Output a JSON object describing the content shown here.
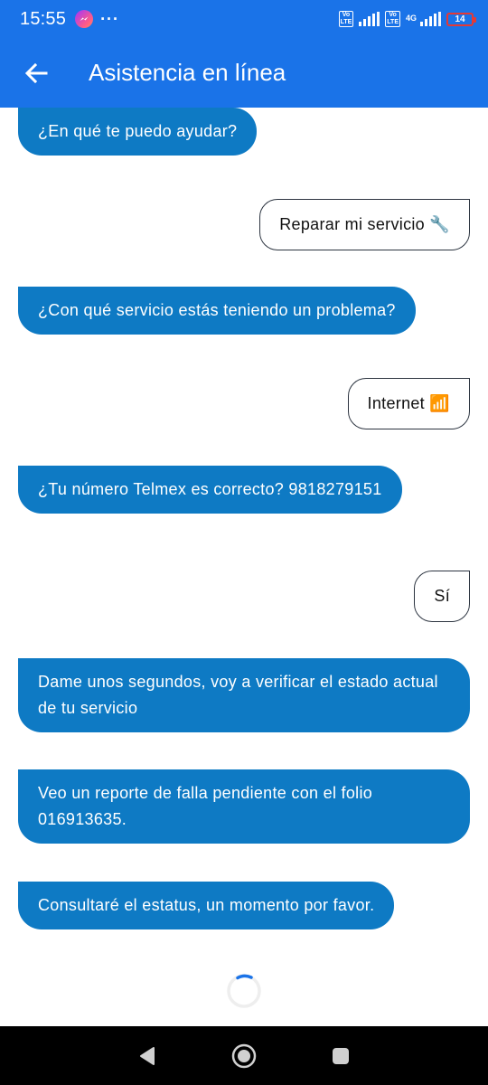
{
  "status_bar": {
    "time": "15:55",
    "more_dots": "···",
    "volte_1": "Vo LTE",
    "volte_2": "Vo LTE",
    "network_label": "4G",
    "battery_level": "14",
    "colors": {
      "bar": "#1a73e8",
      "battery_low": "#e53935"
    }
  },
  "app_bar": {
    "back_icon": "arrow-left-icon",
    "title": "Asistencia en línea"
  },
  "chat": {
    "messages": [
      {
        "from": "bot",
        "text": "¿En qué te puedo ayudar?"
      },
      {
        "from": "user",
        "text": "Reparar mi servicio 🔧"
      },
      {
        "from": "bot",
        "text": "¿Con qué servicio estás teniendo un problema?"
      },
      {
        "from": "user",
        "text": "Internet 📶"
      },
      {
        "from": "bot",
        "text": "¿Tu número Telmex es correcto? 9818279151"
      },
      {
        "from": "user",
        "text": "Sí"
      },
      {
        "from": "bot",
        "text": "Dame unos segundos, voy a verificar el estado actual de tu servicio"
      },
      {
        "from": "bot",
        "text": "Veo un reporte de falla pendiente con el folio 016913635."
      },
      {
        "from": "bot",
        "text": "Consultaré el estatus, un momento por favor."
      }
    ],
    "loading": true,
    "colors": {
      "bot_bubble": "#0e7ac4",
      "user_border": "#2c3440"
    }
  },
  "nav_bar": {
    "back": "triangle-back-icon",
    "home": "circle-home-icon",
    "recents": "square-recents-icon"
  }
}
